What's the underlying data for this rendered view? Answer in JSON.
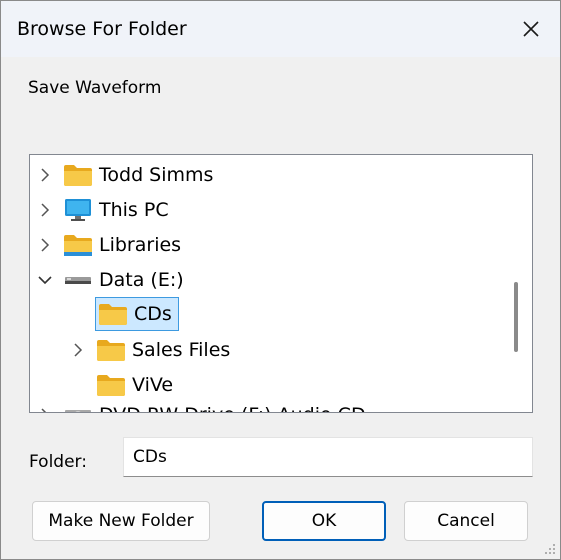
{
  "window": {
    "title": "Browse For Folder"
  },
  "instruction": "Save Waveform",
  "tree": [
    {
      "label": "Todd Simms",
      "chevron": "right",
      "icon": "folder-icon",
      "selected": false
    },
    {
      "label": "This PC",
      "chevron": "right",
      "icon": "monitor-icon",
      "selected": false
    },
    {
      "label": "Libraries",
      "chevron": "right",
      "icon": "library-folder-icon",
      "selected": false
    },
    {
      "label": "Data (E:)",
      "chevron": "down",
      "icon": "drive-icon",
      "selected": false
    },
    {
      "label": "CDs",
      "chevron": "none",
      "icon": "folder-icon",
      "selected": true
    },
    {
      "label": "Sales Files",
      "chevron": "right",
      "icon": "folder-icon",
      "selected": false
    },
    {
      "label": "ViVe",
      "chevron": "none",
      "icon": "folder-icon",
      "selected": false
    },
    {
      "label": "DVD RW Drive (F:) Audio CD",
      "chevron": "right",
      "icon": "optical-drive-icon",
      "selected": false
    }
  ],
  "folder": {
    "label": "Folder:",
    "value": "CDs"
  },
  "buttons": {
    "make_new_folder": "Make New Folder",
    "ok": "OK",
    "cancel": "Cancel"
  },
  "colors": {
    "selection_bg": "#cce8ff",
    "selection_border": "#3d9ae0",
    "folder_yellow": "#f7c948",
    "accent": "#005fb8"
  }
}
